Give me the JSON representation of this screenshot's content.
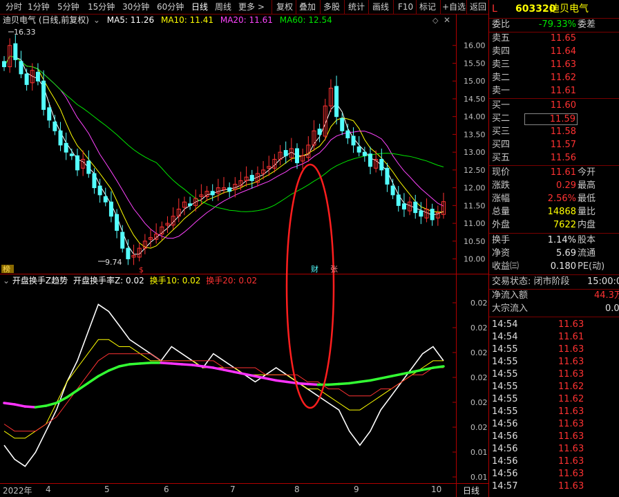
{
  "toolbar": {
    "items": [
      "分时",
      "1分钟",
      "5分钟",
      "15分钟",
      "30分钟",
      "60分钟",
      "日线",
      "周线",
      "更多 >"
    ],
    "active_index": 6,
    "right_items": [
      "复权",
      "叠加",
      "多股",
      "统计",
      "画线",
      "F10",
      "标记",
      "+自选",
      "返回"
    ]
  },
  "main_chart": {
    "title": "迪贝电气 (日线,前复权)",
    "ma_legend": [
      {
        "label": "MA5: 11.26",
        "color": "#ffffff"
      },
      {
        "label": "MA10: 11.41",
        "color": "#ffff00"
      },
      {
        "label": "MA20: 11.61",
        "color": "#ff44ff"
      },
      {
        "label": "MA60: 12.54",
        "color": "#00e600"
      }
    ],
    "high_label": "16.33",
    "low_label": "9.74",
    "markers": [
      "榜",
      "$",
      "财",
      "张"
    ],
    "colors": {
      "up": "#ff3232",
      "down": "#54ffff",
      "ma5": "#ffffff",
      "ma10": "#ffff00",
      "ma20": "#ff44ff",
      "ma60": "#00e600"
    }
  },
  "sub_chart": {
    "legend": [
      {
        "label": "开盘换手Z趋势",
        "color": "#ffffff"
      },
      {
        "label": "开盘换手率Z: 0.02",
        "color": "#ffffff"
      },
      {
        "label": "换手10: 0.02",
        "color": "#ffff00"
      },
      {
        "label": "换手20: 0.02",
        "color": "#ff3232"
      }
    ]
  },
  "x_axis": {
    "labels": [
      "2022年",
      "4",
      "5",
      "6",
      "7",
      "8",
      "9",
      "10"
    ],
    "period": "日线"
  },
  "chart_data": [
    {
      "type": "candlestick",
      "yticks": [
        16.0,
        15.5,
        15.0,
        14.5,
        14.0,
        13.5,
        13.0,
        12.5,
        12.0,
        11.5,
        11.0,
        10.5,
        10.0
      ],
      "ylim": [
        9.7,
        16.5
      ],
      "close_series": [
        15.4,
        16.0,
        15.6,
        15.2,
        14.9,
        15.3,
        15.0,
        14.2,
        13.9,
        13.6,
        13.2,
        13.0,
        12.9,
        12.5,
        12.8,
        12.4,
        12.0,
        11.8,
        11.6,
        11.2,
        10.8,
        10.3,
        10.0,
        10.1,
        10.3,
        10.5,
        10.6,
        10.7,
        10.9,
        11.0,
        11.2,
        11.4,
        11.6,
        11.5,
        11.7,
        11.8,
        11.9,
        11.8,
        12.0,
        12.0,
        11.9,
        12.1,
        12.2,
        12.3,
        12.2,
        12.4,
        12.5,
        12.6,
        12.8,
        13.0,
        12.9,
        13.1,
        12.7,
        12.9,
        13.2,
        13.6,
        13.5,
        14.3,
        14.8,
        14.0,
        13.6,
        13.4,
        13.2,
        13.0,
        12.9,
        12.6,
        12.8,
        12.5,
        12.1,
        11.8,
        11.5,
        11.4,
        11.6,
        11.3,
        11.2,
        11.4,
        11.1,
        11.3,
        11.61
      ],
      "last_values": {
        "MA5": 11.26,
        "MA10": 11.41,
        "MA20": 11.61,
        "MA60": 12.54
      },
      "high": 16.33,
      "low": 9.74
    },
    {
      "type": "line",
      "yticks": [
        0.02,
        0.02,
        0.02,
        0.02,
        0.02,
        0.02,
        0.01,
        0.01
      ],
      "series": [
        {
          "name": "开盘换手率Z",
          "values": [
            0.01,
            0.008,
            0.007,
            0.009,
            0.012,
            0.015,
            0.019,
            0.022,
            0.026,
            0.03,
            0.029,
            0.027,
            0.025,
            0.024,
            0.023,
            0.022,
            0.024,
            0.023,
            0.022,
            0.021,
            0.023,
            0.022,
            0.021,
            0.02,
            0.019,
            0.02,
            0.021,
            0.02,
            0.019,
            0.018,
            0.017,
            0.016,
            0.015,
            0.012,
            0.01,
            0.012,
            0.015,
            0.017,
            0.019,
            0.021,
            0.023,
            0.024,
            0.022
          ]
        },
        {
          "name": "换手10",
          "values": [
            0.012,
            0.011,
            0.011,
            0.012,
            0.013,
            0.016,
            0.019,
            0.021,
            0.023,
            0.025,
            0.025,
            0.024,
            0.024,
            0.023,
            0.022,
            0.022,
            0.022,
            0.022,
            0.022,
            0.021,
            0.021,
            0.021,
            0.021,
            0.02,
            0.02,
            0.02,
            0.02,
            0.02,
            0.019,
            0.018,
            0.018,
            0.017,
            0.016,
            0.015,
            0.015,
            0.016,
            0.017,
            0.018,
            0.019,
            0.02,
            0.021,
            0.022,
            0.022
          ]
        },
        {
          "name": "换手20",
          "values": [
            0.013,
            0.012,
            0.012,
            0.012,
            0.013,
            0.014,
            0.016,
            0.018,
            0.02,
            0.022,
            0.023,
            0.023,
            0.023,
            0.023,
            0.023,
            0.022,
            0.022,
            0.022,
            0.022,
            0.022,
            0.022,
            0.021,
            0.021,
            0.021,
            0.021,
            0.02,
            0.02,
            0.02,
            0.02,
            0.019,
            0.019,
            0.018,
            0.018,
            0.017,
            0.017,
            0.017,
            0.018,
            0.018,
            0.019,
            0.02,
            0.02,
            0.021,
            0.021
          ]
        },
        {
          "name": "开盘换手Z趋势",
          "values": [
            0.016,
            0.0158,
            0.0155,
            0.0154,
            0.0156,
            0.016,
            0.0168,
            0.0178,
            0.0188,
            0.0198,
            0.0206,
            0.0212,
            0.0215,
            0.0216,
            0.0217,
            0.0217,
            0.0216,
            0.0215,
            0.0214,
            0.0212,
            0.021,
            0.0207,
            0.0204,
            0.0201,
            0.0198,
            0.0195,
            0.0192,
            0.019,
            0.0188,
            0.0187,
            0.0186,
            0.0186,
            0.0187,
            0.0188,
            0.019,
            0.0192,
            0.0195,
            0.0198,
            0.0201,
            0.0204,
            0.0207,
            0.021,
            0.0212
          ]
        }
      ]
    }
  ],
  "quote": {
    "flag": "L",
    "code": "603320",
    "name": "迪贝电气",
    "weibi_label": "委比",
    "weibi_value": "-79.33%",
    "weicha_label": "委差",
    "sells": [
      {
        "label": "卖五",
        "price": "11.65"
      },
      {
        "label": "卖四",
        "price": "11.64"
      },
      {
        "label": "卖三",
        "price": "11.63"
      },
      {
        "label": "卖二",
        "price": "11.62"
      },
      {
        "label": "卖一",
        "price": "11.61"
      }
    ],
    "buys": [
      {
        "label": "买一",
        "price": "11.60"
      },
      {
        "label": "买二",
        "price": "11.59"
      },
      {
        "label": "买三",
        "price": "11.58"
      },
      {
        "label": "买四",
        "price": "11.57"
      },
      {
        "label": "买五",
        "price": "11.56"
      }
    ],
    "stats": [
      {
        "l": "现价",
        "v": "11.61",
        "r": "今开",
        "c": "red"
      },
      {
        "l": "涨跌",
        "v": "0.29",
        "r": "最高",
        "c": "red"
      },
      {
        "l": "涨幅",
        "v": "2.56%",
        "r": "最低",
        "c": "red"
      },
      {
        "l": "总量",
        "v": "14868",
        "r": "量比",
        "c": "yellow"
      },
      {
        "l": "外盘",
        "v": "7622",
        "r": "内盘",
        "c": "yellow"
      }
    ],
    "stats2": [
      {
        "l": "换手",
        "v": "1.14%",
        "r": "股本"
      },
      {
        "l": "净资",
        "v": "5.69",
        "r": "流通"
      },
      {
        "l": "收益㈢",
        "v": "0.180",
        "r": "PE(动)"
      }
    ],
    "trade_status_label": "交易状态: 闭市阶段",
    "trade_status_time": "15:00:0",
    "net_inflow_label": "净流入额",
    "net_inflow_value": "44.3万",
    "block_inflow_label": "大宗流入",
    "block_inflow_value": "0.0",
    "ticks": [
      {
        "t": "14:54",
        "p": "11.63"
      },
      {
        "t": "14:54",
        "p": "11.61"
      },
      {
        "t": "14:55",
        "p": "11.63"
      },
      {
        "t": "14:55",
        "p": "11.63"
      },
      {
        "t": "14:55",
        "p": "11.63"
      },
      {
        "t": "14:55",
        "p": "11.62"
      },
      {
        "t": "14:55",
        "p": "11.62"
      },
      {
        "t": "14:55",
        "p": "11.63"
      },
      {
        "t": "14:56",
        "p": "11.63"
      },
      {
        "t": "14:56",
        "p": "11.63"
      },
      {
        "t": "14:56",
        "p": "11.63"
      },
      {
        "t": "14:56",
        "p": "11.63"
      },
      {
        "t": "14:56",
        "p": "11.63"
      },
      {
        "t": "14:57",
        "p": "11.63"
      }
    ]
  }
}
